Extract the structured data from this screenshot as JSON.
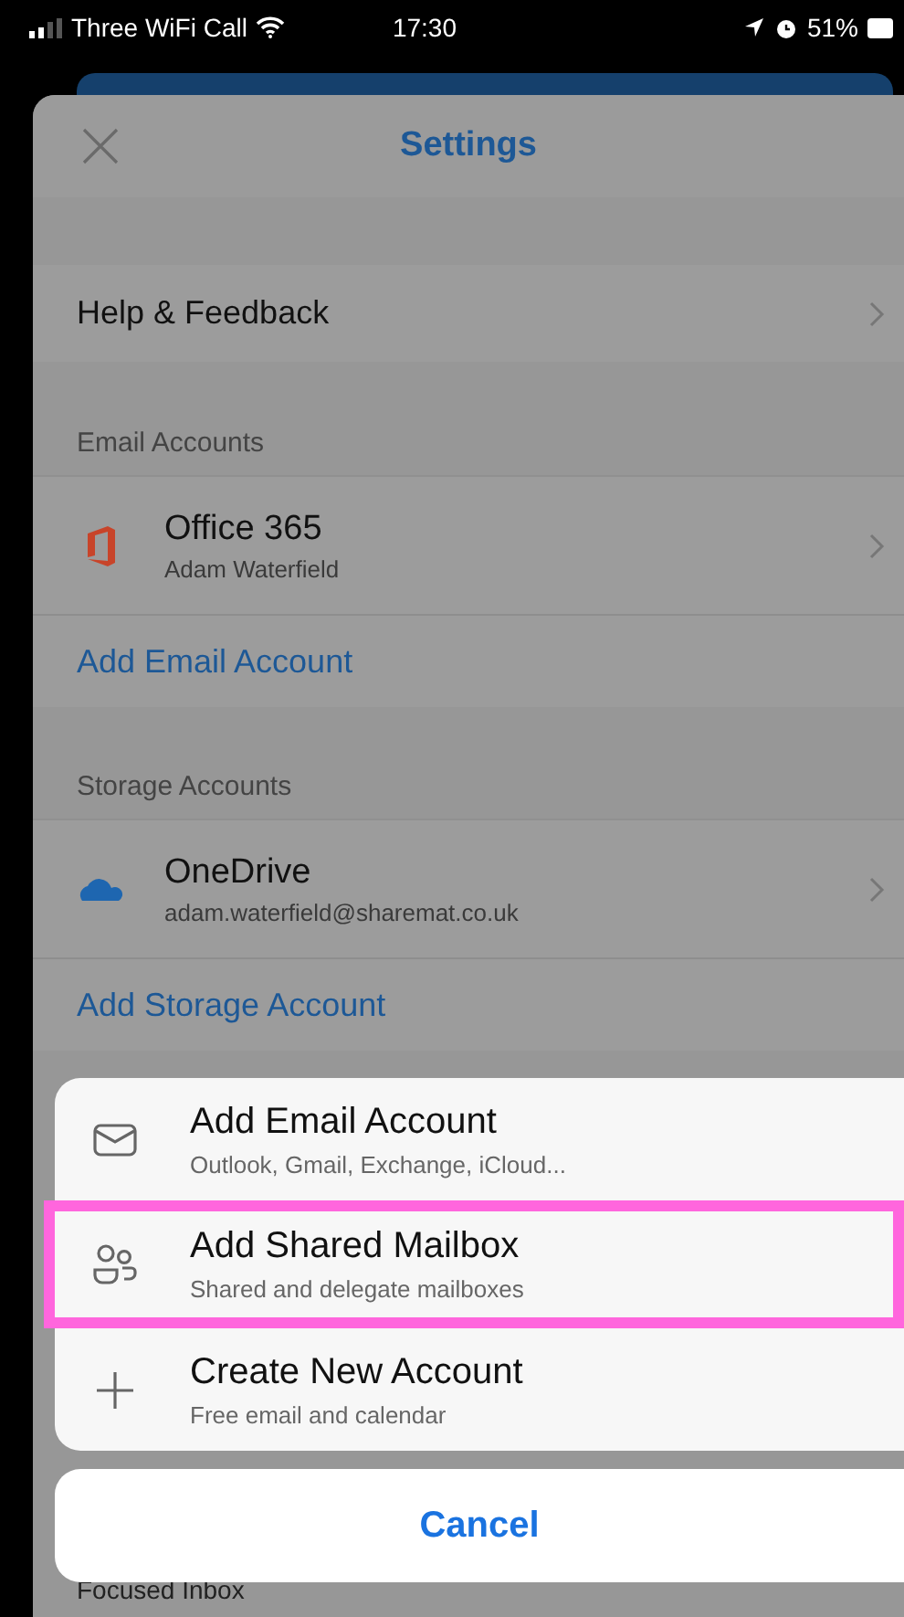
{
  "status_bar": {
    "carrier": "Three WiFi Call",
    "time": "17:30",
    "battery": "51%"
  },
  "header": {
    "title": "Settings"
  },
  "help_row": {
    "label": "Help & Feedback"
  },
  "email_section": {
    "heading": "Email Accounts",
    "accounts": [
      {
        "kind": "office",
        "name": "Office 365",
        "detail": "Adam Waterfield"
      }
    ],
    "add_link": "Add Email Account"
  },
  "storage_section": {
    "heading": "Storage Accounts",
    "accounts": [
      {
        "kind": "onedrive",
        "name": "OneDrive",
        "detail": "adam.waterfield@sharemat.co.uk"
      }
    ],
    "add_link": "Add Storage Account"
  },
  "focused_row": {
    "label": "Focused Inbox"
  },
  "action_sheet": {
    "items": [
      {
        "kind": "mail",
        "title": "Add Email Account",
        "subtitle": "Outlook, Gmail, Exchange, iCloud...",
        "highlighted": false
      },
      {
        "kind": "people",
        "title": "Add Shared Mailbox",
        "subtitle": "Shared and delegate mailboxes",
        "highlighted": true
      },
      {
        "kind": "plus",
        "title": "Create New Account",
        "subtitle": "Free email and calendar",
        "highlighted": false
      }
    ],
    "cancel": "Cancel"
  }
}
